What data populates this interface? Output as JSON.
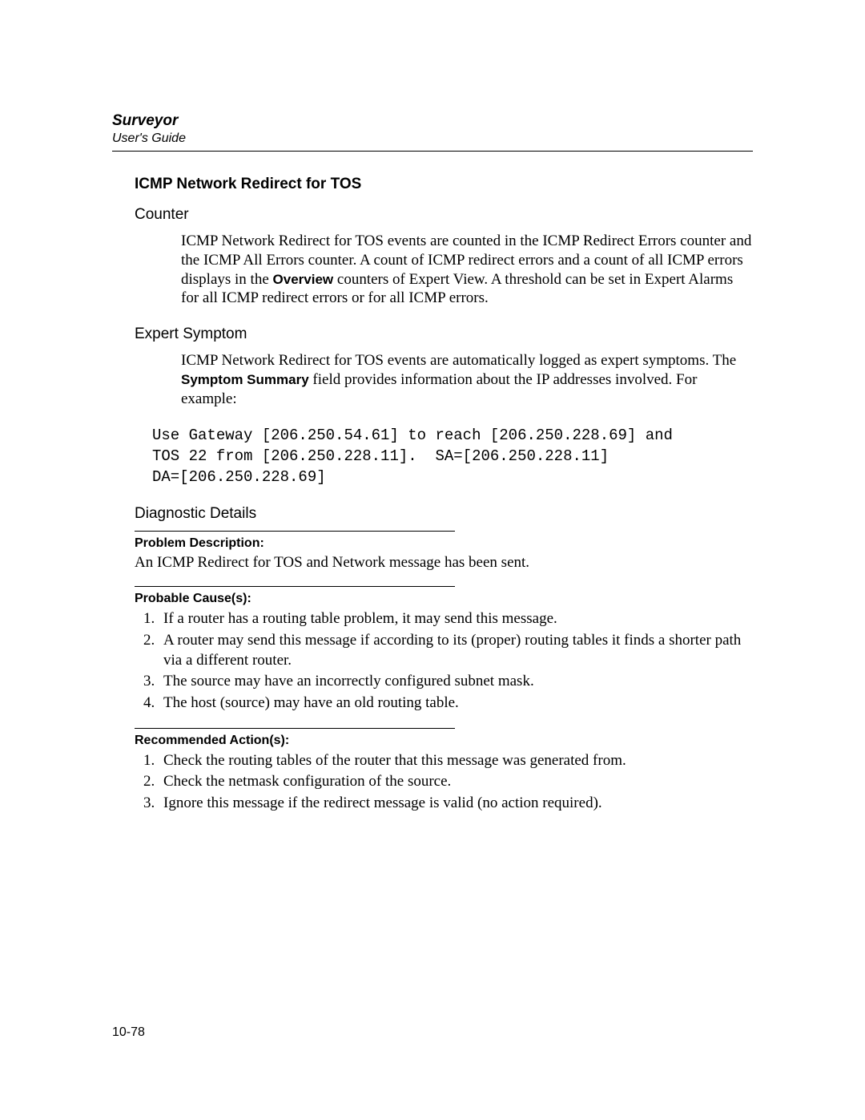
{
  "header": {
    "book_title": "Surveyor",
    "guide_label": "User's Guide"
  },
  "section_title": "ICMP Network Redirect for TOS",
  "counter": {
    "heading": "Counter",
    "para_pre": "ICMP Network Redirect for TOS events are counted in the ICMP Redirect Errors counter and the ICMP All Errors counter. A count of ICMP redirect errors and a count of all ICMP errors displays in the ",
    "overview_label": "Overview",
    "para_post": " counters of Expert View. A threshold can be set in Expert Alarms for all ICMP redirect errors or for all ICMP errors."
  },
  "expert": {
    "heading": "Expert Symptom",
    "para_pre": "ICMP Network Redirect for TOS events are automatically logged as expert symptoms. The ",
    "summary_label": "Symptom Summary",
    "para_post": " field provides information about the IP addresses involved. For example:",
    "code": "Use Gateway [206.250.54.61] to reach [206.250.228.69] and\nTOS 22 from [206.250.228.11].  SA=[206.250.228.11]\nDA=[206.250.228.69]"
  },
  "diagnostic": {
    "heading": "Diagnostic Details",
    "problem_head": "Problem Description:",
    "problem_text": "An ICMP Redirect for TOS and Network message has been sent.",
    "causes_head": "Probable Cause(s):",
    "causes": [
      "If a router has a routing table problem, it may send this message.",
      "A router may send this message if according to its (proper) routing tables it finds a shorter path via a different router.",
      "The source may have an incorrectly configured subnet mask.",
      "The host (source) may have an old routing table."
    ],
    "actions_head": "Recommended Action(s):",
    "actions": [
      "Check the routing tables of the router that this message was generated from.",
      "Check the netmask configuration of the source.",
      "Ignore this message if the redirect message is valid (no action required)."
    ]
  },
  "page_number": "10-78"
}
